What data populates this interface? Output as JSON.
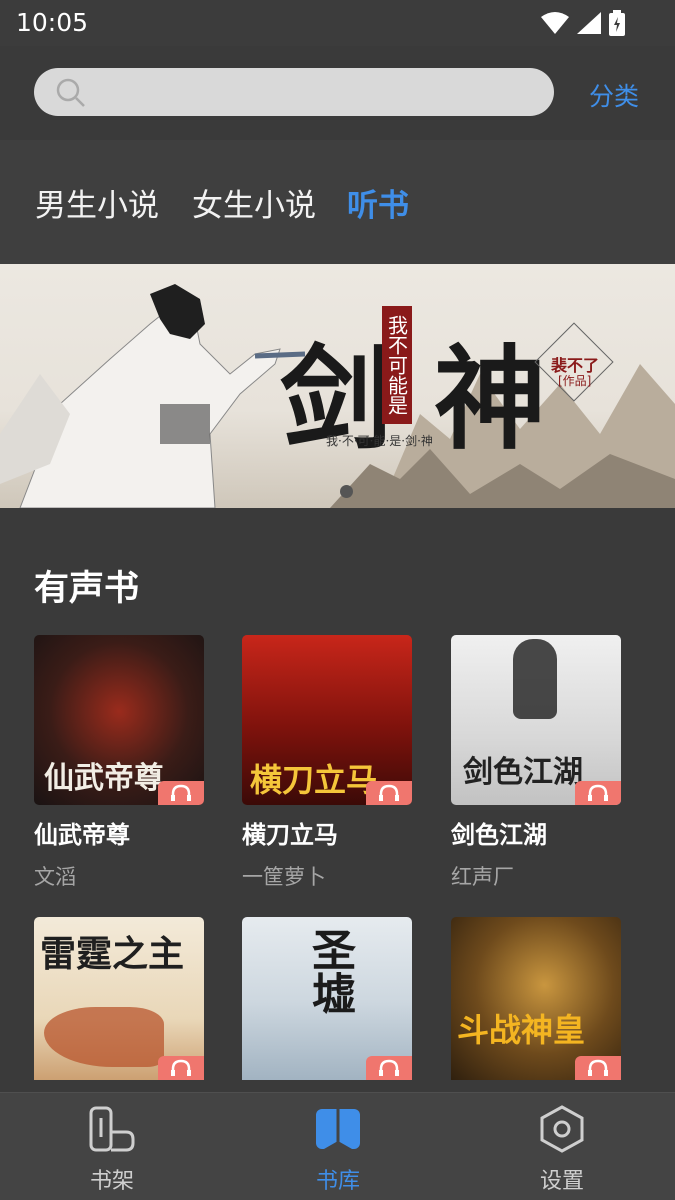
{
  "status_bar": {
    "time": "10:05"
  },
  "search": {
    "placeholder": ""
  },
  "header": {
    "category_label": "分类"
  },
  "tabs": [
    {
      "label": "男生小说"
    },
    {
      "label": "女生小说"
    },
    {
      "label": "听书",
      "active": true
    }
  ],
  "banner": {
    "title": "剑神",
    "subtitle": "我不可能是",
    "tagline": "我·不·可·能·是·剑·神",
    "author_badge": "裴不了",
    "author_badge_sub": "[作品]"
  },
  "section": {
    "title": "有声书"
  },
  "books": [
    {
      "title": "仙武帝尊",
      "author": "文滔",
      "cover_text": "仙武帝尊",
      "cover_color": "#5a2a22"
    },
    {
      "title": "横刀立马",
      "author": "一筐萝卜",
      "cover_text": "横刀立马",
      "cover_color": "#8a1b12"
    },
    {
      "title": "剑色江湖",
      "author": "红声厂",
      "cover_text": "剑色江湖",
      "cover_color": "#dcdcdc"
    },
    {
      "title": "",
      "author": "",
      "cover_text": "雷霆之主",
      "cover_color": "#efe3cf"
    },
    {
      "title": "",
      "author": "",
      "cover_text": "圣墟",
      "cover_color": "#dfe5ea"
    },
    {
      "title": "",
      "author": "",
      "cover_text": "斗战神皇",
      "cover_color": "#4a3516"
    }
  ],
  "bottom_nav": [
    {
      "label": "书架",
      "icon": "bookshelf-icon"
    },
    {
      "label": "书库",
      "icon": "library-icon",
      "active": true
    },
    {
      "label": "设置",
      "icon": "settings-icon"
    }
  ],
  "colors": {
    "accent": "#3f8ee8",
    "background": "#3a3a3a",
    "badge": "#f0766e"
  }
}
